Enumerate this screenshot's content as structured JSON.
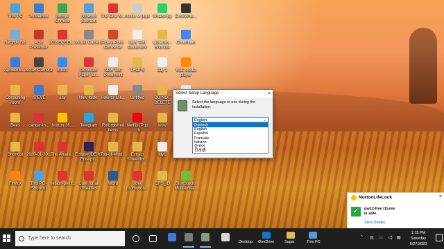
{
  "desktop": {
    "icons": [
      {
        "label": "This PC",
        "color": "#4aa3df"
      },
      {
        "label": "Recycle Bin",
        "color": "#6fb0e0"
      },
      {
        "label": "ApowerMi...",
        "color": "#2d7fe0"
      },
      {
        "label": "Consulting room",
        "color": "#e6b84a"
      },
      {
        "label": "Bees",
        "color": "#e6b84a"
      },
      {
        "label": "Shortcut",
        "color": "#e6b84a"
      },
      {
        "label": "Firefox",
        "color": "#ff7f1f"
      },
      {
        "label": "VirtualBox",
        "color": "#3a7bd5"
      },
      {
        "label": "Acer Presenter",
        "color": "#c0392b"
      },
      {
        "label": "Smart Camera",
        "color": "#444444"
      },
      {
        "label": "IS EVE",
        "color": "#3a7bd5"
      },
      {
        "label": "cancer-in...",
        "color": "#d33"
      },
      {
        "label": "2020-01-30...",
        "color": "#d33"
      },
      {
        "label": "This PC - Shortcut",
        "color": "#4aa3df"
      },
      {
        "label": "Google Chrome",
        "color": "#34a853"
      },
      {
        "label": "2019EQSEL...",
        "color": "#d33"
      },
      {
        "label": "Zoom",
        "color": "#2d8cff"
      },
      {
        "label": "Jay",
        "color": "#e6b84a"
      },
      {
        "label": "Norton 36...",
        "color": "#ffc400"
      },
      {
        "label": "The Amala...",
        "color": "#d33"
      },
      {
        "label": "nelson-pied...",
        "color": "#d33"
      },
      {
        "label": "Network Shortcut",
        "color": "#4aa3df"
      },
      {
        "label": "Virtual Camera",
        "color": "#888888"
      },
      {
        "label": "Generate Paper for...",
        "color": "#d33"
      },
      {
        "label": "New folder",
        "color": "#e6b84a"
      },
      {
        "label": "Telegram",
        "color": "#2aa3e0"
      },
      {
        "label": "Eclipse IDE for Enterpr...",
        "color": "#2c2255"
      },
      {
        "label": "Cure for all diseases",
        "color": "#d33"
      },
      {
        "label": "The-One-M...",
        "color": "#d33"
      },
      {
        "label": "PowerPoint Converter",
        "color": "#d24726"
      },
      {
        "label": "New Text Document",
        "color": "#eeeeee"
      },
      {
        "label": "How-to-ask...",
        "color": "#eeeeee"
      },
      {
        "label": "Refurbished Items",
        "color": "#e6b84a"
      },
      {
        "label": "Top-of-Mind...",
        "color": "#e6b84a"
      },
      {
        "label": "Word",
        "color": "#2b5797"
      },
      {
        "label": "netflix vi popt",
        "color": "#cccccc"
      },
      {
        "label": "New Text Document",
        "color": "#eeeeee"
      },
      {
        "label": "THOPS",
        "color": "#e6b84a"
      },
      {
        "label": "Untitled",
        "color": "#888888"
      },
      {
        "label": "Netflix (Pop UI)",
        "color": "#e50914"
      },
      {
        "label": "Extract Screenfor...",
        "color": "#e6b84a"
      },
      {
        "label": "video promotion...",
        "color": "#d33"
      },
      {
        "label": "WhatsApp",
        "color": "#25d366"
      },
      {
        "label": "Libraries - Shortcut",
        "color": "#e6b84a"
      },
      {
        "label": "Jay 1",
        "color": "#eeeeee"
      },
      {
        "label": "DO NOT DELETE",
        "color": "#e6b84a"
      },
      {
        "label": "wow",
        "color": "#e6b84a"
      },
      {
        "label": "lay1",
        "color": "#eeeeee"
      },
      {
        "label": "CRS_ID",
        "color": "#e6b84a"
      },
      {
        "label": "DeskWho...",
        "color": "#333333"
      },
      {
        "label": "Chromium",
        "color": "#4285f4"
      },
      {
        "label": "VLC media player",
        "color": "#ff8800"
      },
      {
        "label": "[DSP-N380...",
        "color": "#eeeeee"
      },
      {
        "label": "BlueStacks",
        "color": "#6fbf3a"
      },
      {
        "label": "UNIX",
        "color": "#eeeeee"
      },
      {
        "label": "BlueStacks Multi-Insta...",
        "color": "#6fbf3a"
      }
    ]
  },
  "dialog": {
    "title": "Select Setup Language",
    "close": "×",
    "message": "Select the language to use during the installation:",
    "selected": "English",
    "options": [
      "Deutsch",
      "English",
      "Español",
      "Français",
      "Italiano",
      "한국어",
      "日本語"
    ],
    "highlighted_index": 0
  },
  "norton": {
    "brand": "NortonLifeLock",
    "close": "×",
    "message_line1": "pw12-free (1).exe",
    "message_line2": "is safe.",
    "link": "View Details"
  },
  "taskbar": {
    "search_placeholder": "Type here to search",
    "desktop_label": "Desktop",
    "onedrive_label": "OneDrive",
    "sagar_label": "Sagar",
    "thispc_label": "This PC",
    "time": "1:15 PM",
    "day": "Saturday",
    "date": "6/27/2020",
    "tray_chevron": "^",
    "accent": "#7fb8ff"
  }
}
